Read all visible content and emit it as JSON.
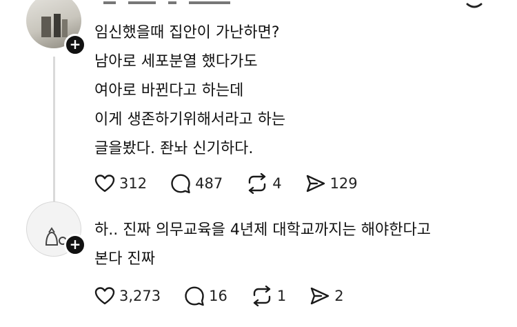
{
  "posts": [
    {
      "body": "임신했을때 집안이 가난하면?\n남아로 세포분열 했다가도\n여아로 바뀐다고 하는데\n이게 생존하기위해서라고 하는\n글을봤다. 좐놔 신기하다.",
      "likes": "312",
      "replies": "487",
      "reposts": "4",
      "shares": "129"
    },
    {
      "body": "하.. 진짜 의무교육을 4년제 대학교까지는 해야한다고\n본다 진짜",
      "likes": "3,273",
      "replies": "16",
      "reposts": "1",
      "shares": "2"
    }
  ],
  "icons": {
    "like": "heart-icon",
    "reply": "comment-icon",
    "repost": "repost-icon",
    "share": "share-icon",
    "follow": "plus-icon",
    "more": "more-icon"
  },
  "colors": {
    "text": "#111111",
    "icon": "#1a1a1a",
    "thread": "#d9d9d9",
    "badge": "#111111"
  },
  "badge_symbol": "+"
}
